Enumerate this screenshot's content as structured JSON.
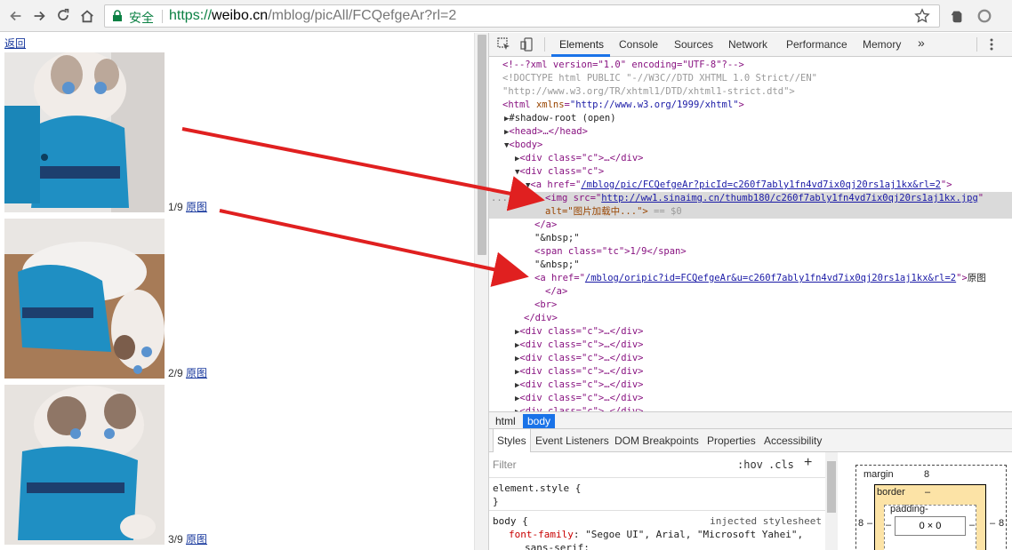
{
  "browser": {
    "secure_label": "安全",
    "url_proto": "https://",
    "url_host": "weibo.cn",
    "url_path": "/mblog/picAll/FCQefgeAr?rl=2"
  },
  "page": {
    "back_label": "返回",
    "photos": [
      {
        "index": "1/9",
        "link": "原图"
      },
      {
        "index": "2/9",
        "link": "原图"
      },
      {
        "index": "3/9",
        "link": "原图"
      }
    ]
  },
  "devtools": {
    "tabs": [
      "Elements",
      "Console",
      "Sources",
      "Network",
      "Performance",
      "Memory"
    ],
    "more": "»",
    "active_tab": "Elements",
    "code": {
      "l1": "<!--?xml version=\"1.0\" encoding=\"UTF-8\"?-->",
      "l2": "<!DOCTYPE html PUBLIC \"-//W3C//DTD XHTML 1.0 Strict//EN\"",
      "l3": "\"http://www.w3.org/TR/xhtml1/DTD/xhtml1-strict.dtd\">",
      "html_open": "<html",
      "xmlns_attr": "xmlns",
      "xmlns_val": "\"http://www.w3.org/1999/xhtml\"",
      "shadow": "#shadow-root (open)",
      "head": "<head>…</head>",
      "body_open": "<body>",
      "div_c_closed": "<div class=\"c\">…</div>",
      "div_c_open": "<div class=\"c\">",
      "a_href_open": "<a href=\"",
      "a_href_val": "/mblog/pic/FCQefgeAr?picId=c260f7ably1fn4vd7ix0qj20rs1aj1kx&rl=2",
      "a_href_close": "\">",
      "img_src_open": "<img src=\"",
      "img_src_val": "http://ww1.sinaimg.cn/thumb180/c260f7ably1fn4vd7ix0qj20rs1aj1kx.jpg",
      "img_alt_line_a": "alt=\"图片加载中...\">",
      "img_alt_line_b": " == $0",
      "a_close": "</a>",
      "nbsp": "\"&nbsp;\"",
      "span_tc": "<span class=\"tc\">1/9</span>",
      "a2_href_val": "/mblog/oripic?id=FCQefgeAr&u=c260f7ably1fn4vd7ix0qj20rs1aj1kx&rl=2",
      "yuantu": "原图",
      "br": "<br>",
      "div_close": "</div>",
      "ellipsis_dots": "..."
    },
    "crumbs": [
      "html",
      "body"
    ],
    "subtabs": [
      "Styles",
      "Event Listeners",
      "DOM Breakpoints",
      "Properties",
      "Accessibility"
    ],
    "styles": {
      "filter_placeholder": "Filter",
      "hov": ":hov",
      "cls": ".cls",
      "plus": "+",
      "element_style": "element.style {",
      "close_brace": "}",
      "body_sel": "body {",
      "injected": "injected stylesheet",
      "font_prop": "font-family",
      "font_val": ": \"Segoe UI\", Arial, \"Microsoft Yahei\",",
      "font_val2": "sans-serif;"
    },
    "boxmodel": {
      "margin_label": "margin",
      "margin_val": "8",
      "border_label": "border",
      "border_val": "–",
      "padding_label": "padding-",
      "content": "0 × 0",
      "side_val": "8",
      "dash": "–"
    }
  },
  "colors": {
    "accent": "#1a73e8",
    "arrow": "#e02020",
    "link": "#1a3a9e"
  }
}
